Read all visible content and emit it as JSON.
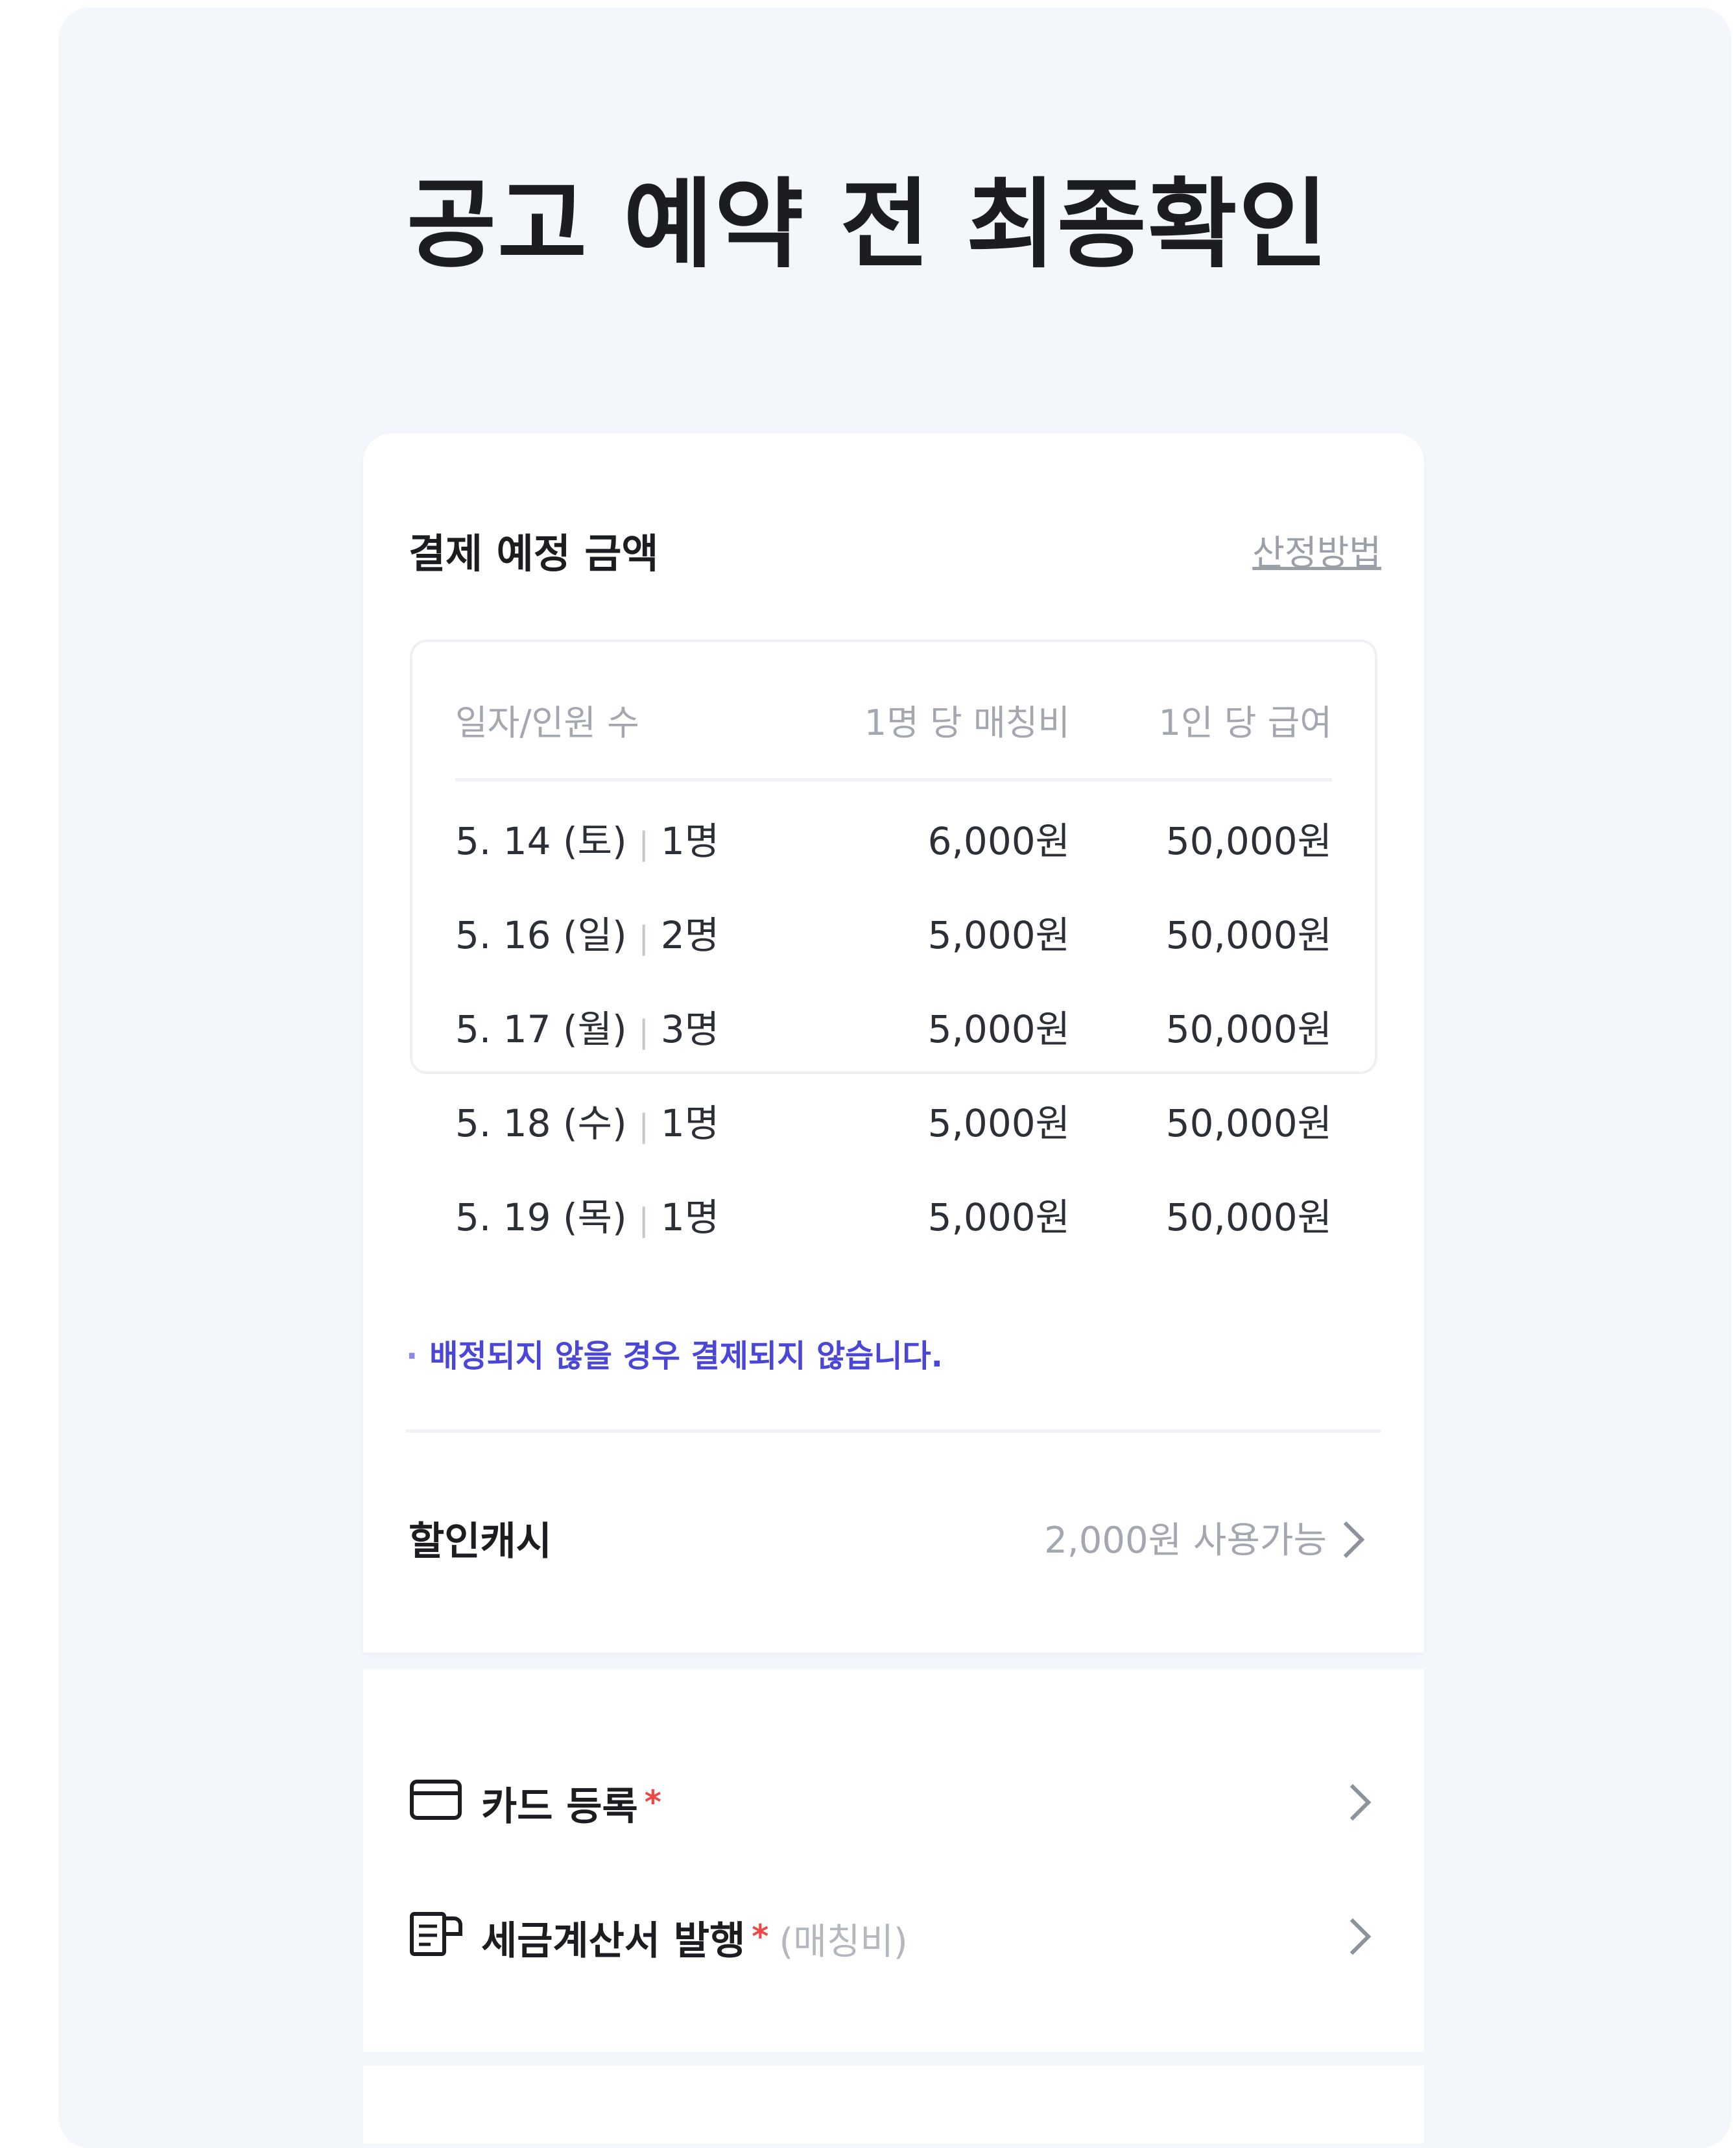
{
  "page": {
    "title": "공고 예약 전 최종확인"
  },
  "payment": {
    "section_title": "결제 예정 금액",
    "calc_link": "산정방법",
    "table": {
      "headers": [
        "일자/인원 수",
        "1명 당 매칭비",
        "1인 당 급여"
      ],
      "rows": [
        {
          "date": "5. 14 (토)",
          "sep": "|",
          "count": "1명",
          "fee": "6,000원",
          "pay": "50,000원"
        },
        {
          "date": "5. 16 (일)",
          "sep": "|",
          "count": "2명",
          "fee": "5,000원",
          "pay": "50,000원"
        },
        {
          "date": "5. 17 (월)",
          "sep": "|",
          "count": "3명",
          "fee": "5,000원",
          "pay": "50,000원"
        },
        {
          "date": "5. 18 (수)",
          "sep": "|",
          "count": "1명",
          "fee": "5,000원",
          "pay": "50,000원"
        },
        {
          "date": "5. 19 (목)",
          "sep": "|",
          "count": "1명",
          "fee": "5,000원",
          "pay": "50,000원"
        }
      ]
    },
    "notice_dot": "·",
    "notice": "배정되지 않을 경우 결제되지 않습니다."
  },
  "discount": {
    "label": "할인캐시",
    "value": "2,000원 사용가능"
  },
  "items": {
    "card": {
      "label": "카드 등록",
      "required_mark": "*",
      "icon": "credit-card-icon"
    },
    "invoice": {
      "label": "세금계산서 발행",
      "required_mark": "*",
      "sub": "(매칭비)",
      "icon": "receipt-icon"
    }
  },
  "colors": {
    "background": "#f3f6fa",
    "accent": "#4a46d8",
    "required": "#f04646"
  }
}
